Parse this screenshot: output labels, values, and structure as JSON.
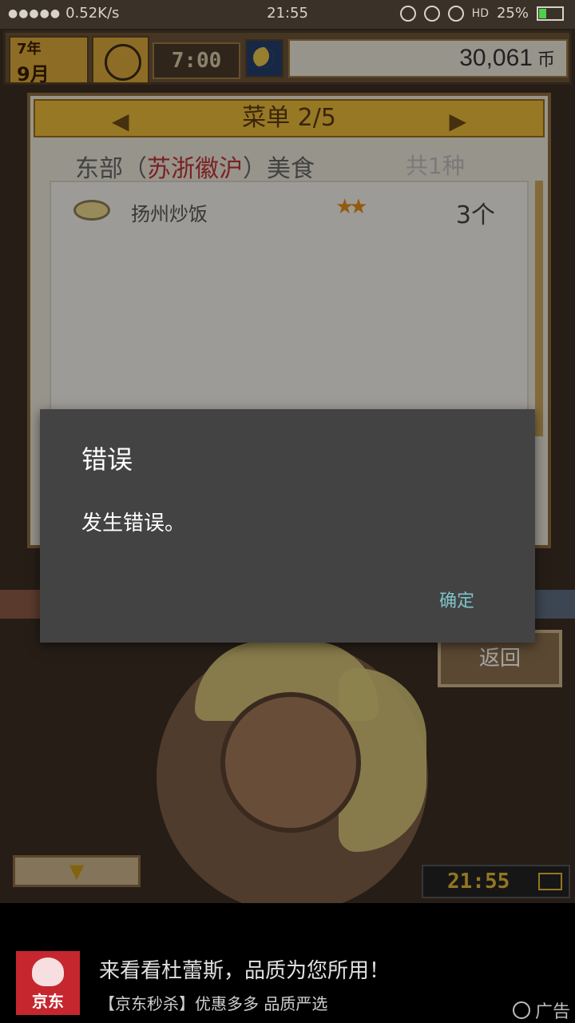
{
  "statusbar": {
    "net_speed": "0.52K/s",
    "time": "21:55",
    "battery_pct": "25%",
    "hd": "HD"
  },
  "game": {
    "date_year": "7年",
    "date_month": "9月",
    "time": "7:00",
    "coins_value": "30,061",
    "coins_unit": "币",
    "menu_header": "菜单 2/5",
    "category_prefix": "东部（",
    "category_highlight": "苏浙徽沪",
    "category_suffix": "）美食",
    "category_count": "共1种",
    "dishes": [
      {
        "name": "扬州炒饭",
        "stars": "★★",
        "quantity": "3个"
      }
    ],
    "back_label": "返回",
    "mini_clock": "21:55"
  },
  "dialog": {
    "title": "错误",
    "message": "发生错误。",
    "ok_label": "确定"
  },
  "ad": {
    "logo_text": "京东",
    "title": "来看看杜蕾斯，品质为您所用！",
    "subtitle": "【京东秒杀】优惠多多 品质严选",
    "tag": "广告"
  }
}
